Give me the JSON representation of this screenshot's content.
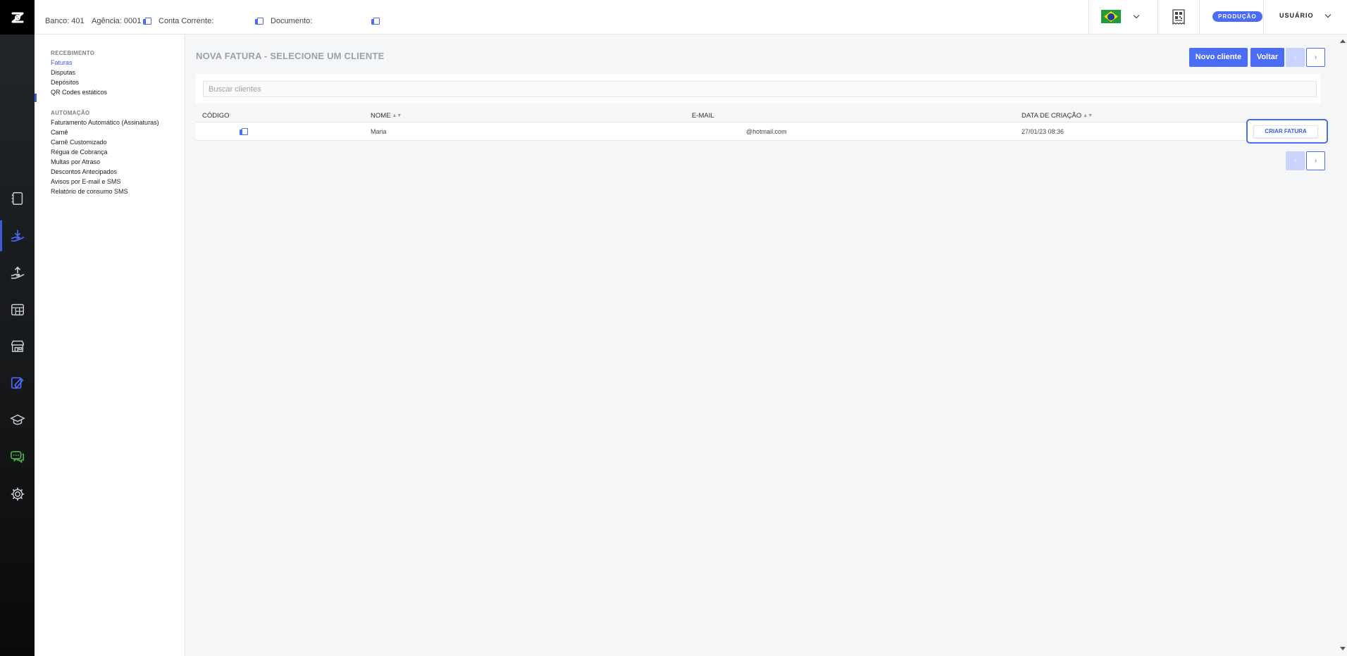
{
  "topbar": {
    "banco": "Banco: 401",
    "agencia": "Agência: 0001",
    "conta": "Conta Corrente:",
    "documento": "Documento:",
    "env_badge": "PRODUÇÃO",
    "user": "USUÁRIO"
  },
  "sidebar": {
    "sections": [
      {
        "title": "RECEBIMENTO",
        "items": [
          "Faturas",
          "Disputas",
          "Depósitos",
          "QR Codes estáticos"
        ]
      },
      {
        "title": "AUTOMAÇÃO",
        "items": [
          "Faturamento Automático (Assinaturas)",
          "Carnê",
          "Carnê Customizado",
          "Régua de Cobrança",
          "Multas por Atraso",
          "Descontos Antecipados",
          "Avisos por E-mail e SMS",
          "Relatório de consumo SMS"
        ]
      }
    ],
    "active_item": "Faturas"
  },
  "main": {
    "title": "NOVA FATURA - SELECIONE UM CLIENTE",
    "new_client_label": "Novo cliente",
    "back_label": "Voltar",
    "prev_label": "‹",
    "next_label": "›",
    "search_placeholder": "Buscar clientes",
    "table": {
      "headers": [
        "CÓDIGO",
        "NOME",
        "E-MAIL",
        "DATA DE CRIAÇÃO"
      ],
      "rows": [
        {
          "codigo": "",
          "nome": "Maria",
          "email": "@hotmail.com",
          "data": "27/01/23 08:36",
          "action": "CRIAR FATURA"
        }
      ]
    }
  },
  "colors": {
    "accent": "#4a6cf7",
    "active_nav": "#3b5bdb",
    "rail": "#151719"
  },
  "icons": [
    "logo-icon",
    "notebook-icon",
    "receive-money-icon",
    "send-money-icon",
    "invoice-grid-icon",
    "store-icon",
    "card-icon",
    "graduation-cap-icon",
    "chat-icon",
    "gear-icon",
    "qr-receipt-icon",
    "copy-icon"
  ]
}
